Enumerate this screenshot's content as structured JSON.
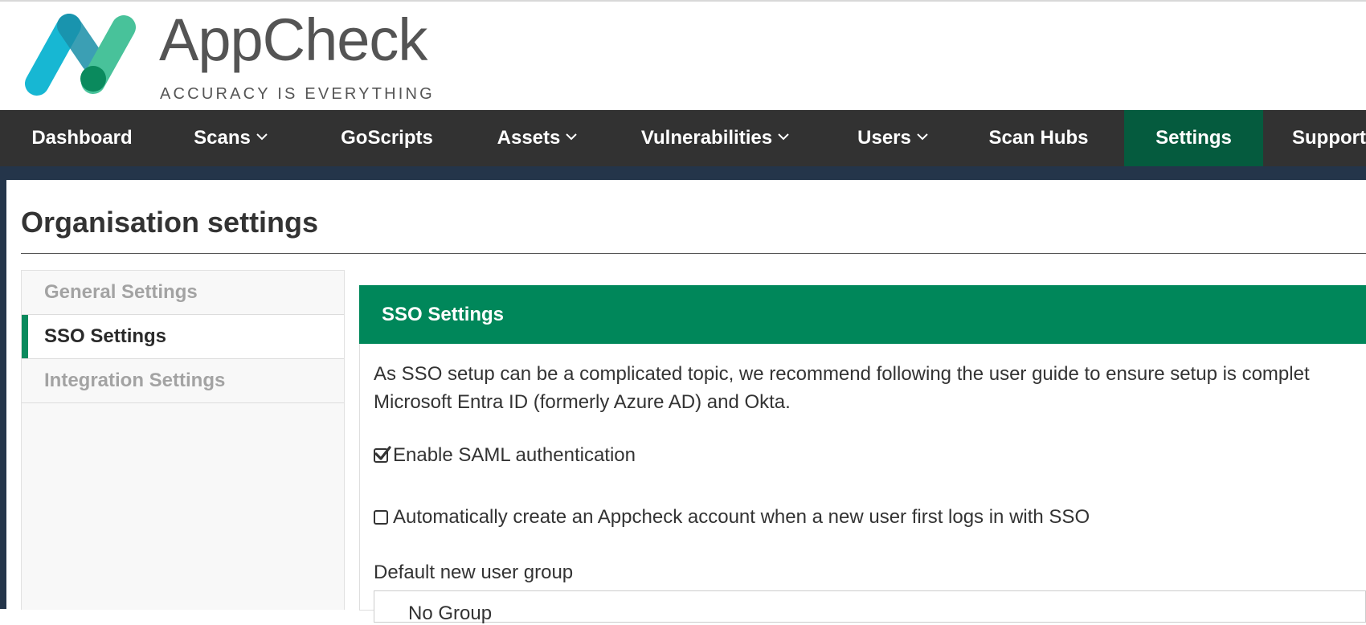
{
  "brand": {
    "name": "AppCheck",
    "tagline": "ACCURACY IS EVERYTHING",
    "colors": {
      "teal_dark": "#1a8fa8",
      "teal": "#17b7d3",
      "green": "#48c29a",
      "green_dark": "#0a8a5d"
    }
  },
  "nav": {
    "items": [
      {
        "label": "Dashboard",
        "dropdown": false
      },
      {
        "label": "Scans",
        "dropdown": true
      },
      {
        "label": "GoScripts",
        "dropdown": false
      },
      {
        "label": "Assets",
        "dropdown": true
      },
      {
        "label": "Vulnerabilities",
        "dropdown": true
      },
      {
        "label": "Users",
        "dropdown": true
      },
      {
        "label": "Scan Hubs",
        "dropdown": false
      },
      {
        "label": "Settings",
        "dropdown": false,
        "active": true
      },
      {
        "label": "Support",
        "dropdown": false
      }
    ],
    "colors": {
      "bar": "#323232",
      "active": "#055b3e"
    }
  },
  "page": {
    "title": "Organisation settings"
  },
  "sidebar": {
    "items": [
      {
        "label": "General Settings",
        "active": false
      },
      {
        "label": "SSO Settings",
        "active": true
      },
      {
        "label": "Integration Settings",
        "active": false
      }
    ]
  },
  "sso": {
    "header": "SSO Settings",
    "intro_line1": "As SSO setup can be a complicated topic, we recommend following the user guide to ensure setup is complet",
    "intro_line2": "Microsoft Entra ID (formerly Azure AD) and Okta.",
    "enable_saml": {
      "label": "Enable SAML authentication",
      "checked": true
    },
    "auto_create": {
      "label": "Automatically create an Appcheck account when a new user first logs in with SSO",
      "checked": false
    },
    "default_group": {
      "label": "Default new user group",
      "value": "No Group"
    },
    "header_color": "#00875a"
  }
}
